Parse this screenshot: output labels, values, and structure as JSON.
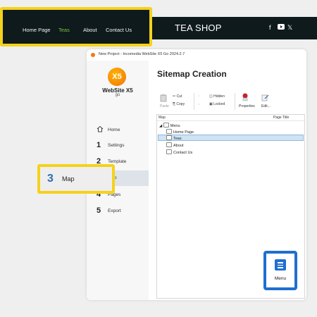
{
  "site": {
    "nav": [
      "Home Page",
      "Teas",
      "About",
      "Contact Us"
    ],
    "active_nav_index": 1,
    "title": "TEA SHOP",
    "social_icons": [
      "facebook-icon",
      "youtube-icon",
      "x-icon"
    ],
    "colors": {
      "bar": "#0f1a1c",
      "active": "#79c342",
      "highlight": "#f4d21c"
    }
  },
  "window": {
    "title": "New Project - Incomedia WebSite X5 Go 2024.2.7",
    "brand": "WebSite X5",
    "brand_sub": "go",
    "logo_text": "X5"
  },
  "steps": [
    {
      "num": "",
      "label": "Home"
    },
    {
      "num": "1",
      "label": "Settings"
    },
    {
      "num": "2",
      "label": "Template"
    },
    {
      "num": "3",
      "label": "Map"
    },
    {
      "num": "4",
      "label": "Pages"
    },
    {
      "num": "5",
      "label": "Export"
    }
  ],
  "main": {
    "title": "Sitemap Creation",
    "toolbar": {
      "paste": "Paste",
      "cut": "Cut",
      "copy": "Copy",
      "hidden": "Hidden",
      "locked": "Locked",
      "properties": "Properties",
      "edit": "Edit..."
    },
    "tree": {
      "col_map": "Map",
      "col_title": "Page Title",
      "root": "Menu",
      "items": [
        "Home Page",
        "Teas",
        "About",
        "Contact Us"
      ],
      "selected": "Teas"
    }
  },
  "callout": {
    "num": "3",
    "label": "Map"
  },
  "menu_button": {
    "label": "Menu"
  }
}
